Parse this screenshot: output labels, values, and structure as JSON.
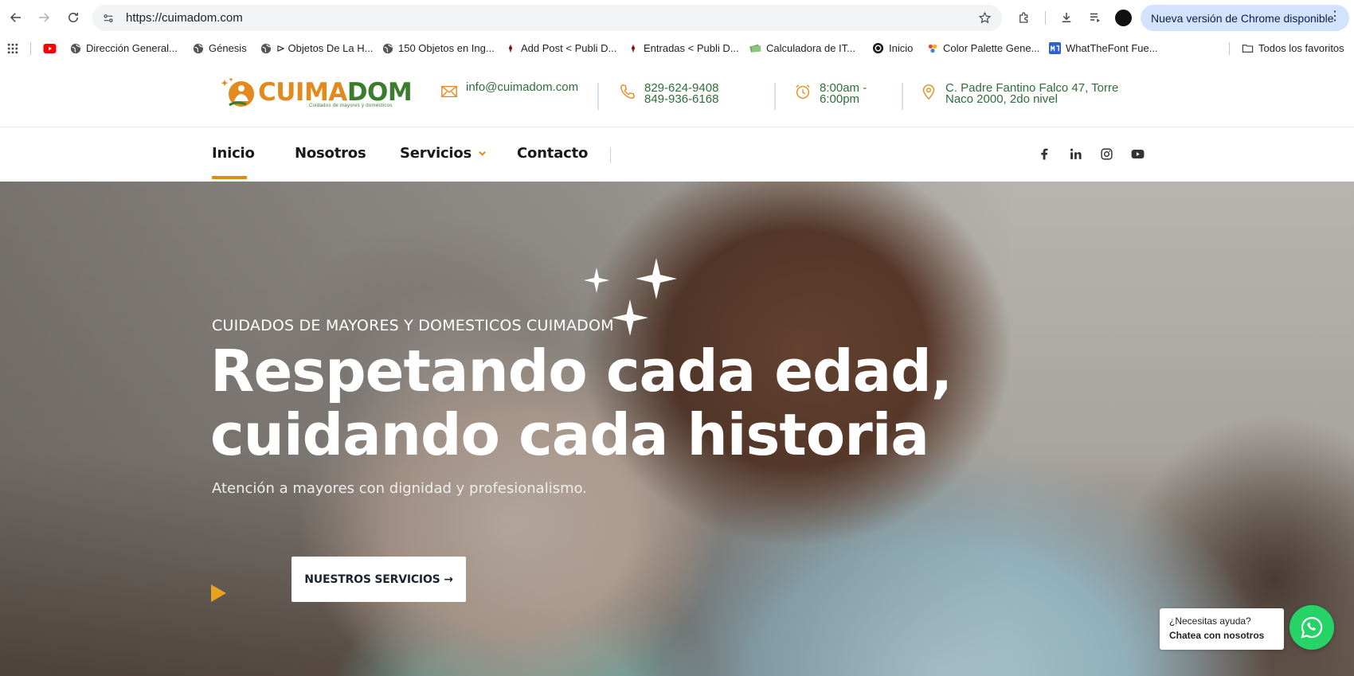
{
  "browser": {
    "url": "https://cuimadom.com",
    "update_label": "Nueva versión de Chrome disponible",
    "avatar_color": "#111111",
    "bookmarks": [
      {
        "label": "Dirección General...",
        "icon": "globe-icon"
      },
      {
        "label": "Génesis",
        "icon": "globe-icon"
      },
      {
        "label": "⊳ Objetos De La H...",
        "icon": "globe-icon"
      },
      {
        "label": "150 Objetos en Ing...",
        "icon": "globe-icon"
      },
      {
        "label": "Add Post < Publi D...",
        "icon": "site-icon"
      },
      {
        "label": "Entradas < Publi D...",
        "icon": "site-icon"
      },
      {
        "label": "Calculadora de IT...",
        "icon": "money-icon"
      },
      {
        "label": "Inicio",
        "icon": "circle-icon"
      },
      {
        "label": "Color Palette Gene...",
        "icon": "palette-icon"
      },
      {
        "label": "WhatTheFont Fue...",
        "icon": "font-icon"
      }
    ],
    "all_bookmarks_label": "Todos los favoritos"
  },
  "site": {
    "logo": {
      "text_a": "CUIMA",
      "text_b": "DOM",
      "tagline": "Cuidados de mayores y domésticos"
    },
    "contact": {
      "email": "info@cuimadom.com",
      "phone1": "829-624-9408",
      "phone2": "849-936-6168",
      "hours1": "8:00am -",
      "hours2": "6:00pm",
      "address1": "C. Padre Fantino Falco 47, Torre",
      "address2": "Naco 2000, 2do nivel"
    },
    "nav": {
      "home": "Inicio",
      "about": "Nosotros",
      "services": "Servicios",
      "contact": "Contacto"
    },
    "hero": {
      "kicker": "CUIDADOS DE MAYORES Y DOMESTICOS CUIMADOM",
      "title_line1": "Respetando cada edad,",
      "title_line2": "cuidando cada historia",
      "subtitle": "Atención a mayores con dignidad y profesionalismo.",
      "cta": "NUESTROS SERVICIOS →"
    },
    "chat": {
      "line1": "¿Necesitas ayuda?",
      "line2": "Chatea con nosotros"
    },
    "colors": {
      "accent": "#e38a1c",
      "brand_green": "#2f6d3a",
      "whatsapp": "#25d366"
    }
  }
}
